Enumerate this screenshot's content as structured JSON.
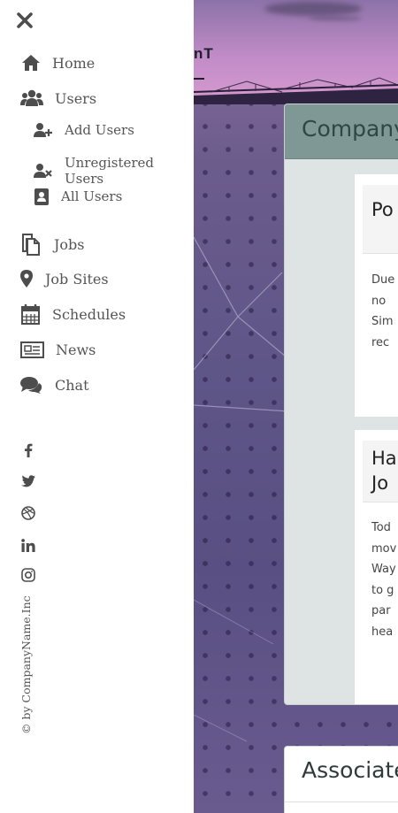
{
  "sidebar": {
    "close_icon": "close-icon",
    "nav": [
      {
        "label": "Home",
        "icon": "home-icon"
      },
      {
        "label": "Users",
        "icon": "users-icon"
      },
      {
        "label": "Add Users",
        "icon": "user-plus-icon"
      },
      {
        "label": "Unregistered Users",
        "icon": "user-times-icon"
      },
      {
        "label": "All Users",
        "icon": "address-book-icon"
      },
      {
        "label": "Jobs",
        "icon": "copy-icon"
      },
      {
        "label": "Job Sites",
        "icon": "map-marker-icon"
      },
      {
        "label": "Schedules",
        "icon": "calendar-icon"
      },
      {
        "label": "News",
        "icon": "newspaper-icon"
      },
      {
        "label": "Chat",
        "icon": "comments-icon"
      }
    ],
    "social": [
      "facebook-icon",
      "twitter-icon",
      "dribbble-icon",
      "linkedin-icon",
      "instagram-icon"
    ],
    "copyright": "© by CompanyName.Inc"
  },
  "header": {
    "brand_fragment": "nT"
  },
  "company_panel": {
    "title": "Company",
    "cards": [
      {
        "title": "Po",
        "body_lines": [
          "Due",
          "no",
          "Sim",
          "rec"
        ]
      },
      {
        "title_lines": [
          "Ha",
          "Jo"
        ],
        "body_lines": [
          "Tod",
          "mov",
          "Way",
          "to g",
          "par",
          "hea"
        ]
      }
    ]
  },
  "associates_panel": {
    "title": "Associate"
  },
  "colors": {
    "panel_header": "#7f9895",
    "panel_bg": "#dde4e3",
    "sidebar_text": "#555555",
    "background_purple": "#5f5688"
  }
}
